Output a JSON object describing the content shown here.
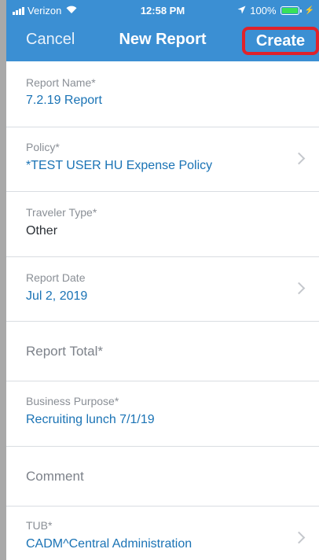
{
  "status_bar": {
    "carrier": "Verizon",
    "time": "12:58 PM",
    "battery": "100%",
    "battery_level": 1.0
  },
  "nav": {
    "cancel_label": "Cancel",
    "title": "New Report",
    "create_label": "Create"
  },
  "colors": {
    "header": "#3b8fd3",
    "value_blue": "#1a73b5",
    "highlight_red": "#e0222a"
  },
  "form": {
    "report_name": {
      "label": "Report Name*",
      "value": "7.2.19 Report"
    },
    "policy": {
      "label": "Policy*",
      "value": "*TEST USER HU Expense Policy"
    },
    "traveler_type": {
      "label": "Traveler Type*",
      "value": "Other"
    },
    "report_date": {
      "label": "Report Date",
      "value": "Jul 2, 2019"
    },
    "report_total": {
      "placeholder": "Report Total*"
    },
    "business_purpose": {
      "label": "Business Purpose*",
      "value": "Recruiting lunch 7/1/19"
    },
    "comment": {
      "placeholder": "Comment"
    },
    "tub": {
      "label": "TUB*",
      "value": "CADM^Central Administration"
    }
  },
  "icons": [
    "signal-icon",
    "wifi-icon",
    "location-arrow-icon",
    "battery-icon",
    "charging-bolt-icon",
    "chevron-right-icon"
  ]
}
